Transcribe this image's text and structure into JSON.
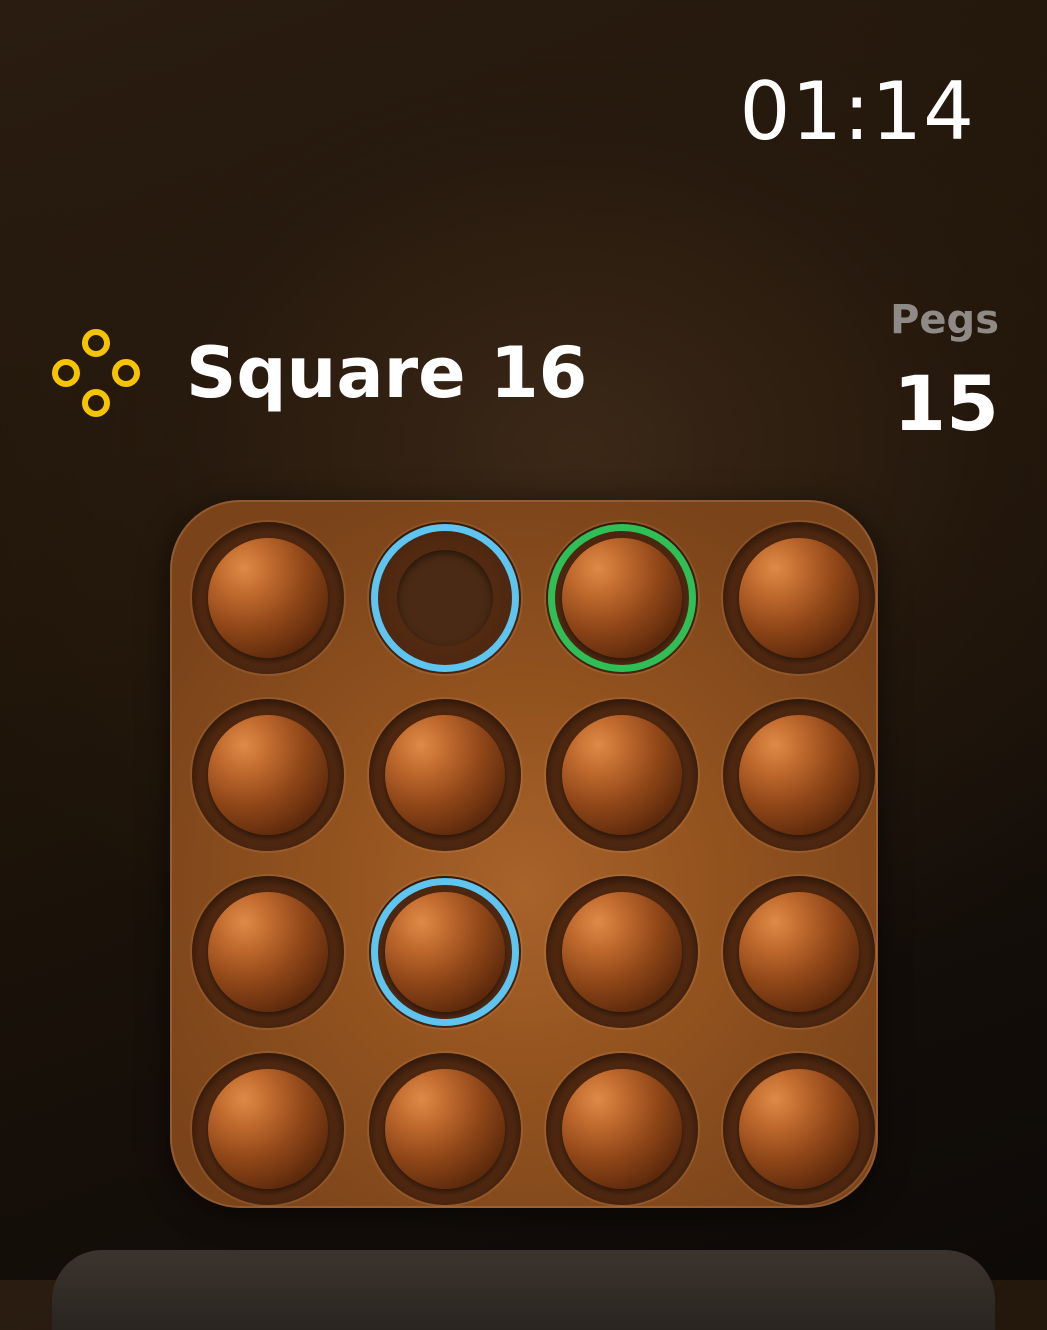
{
  "status": {
    "time": "01:14"
  },
  "header": {
    "title": "Square 16",
    "icon": "four-rings-icon",
    "icon_color": "#f5c400"
  },
  "pegs": {
    "label": "Pegs",
    "value": "15"
  },
  "colors": {
    "highlight_blue": "#5ec4f0",
    "highlight_green": "#2fbf56"
  },
  "board": {
    "rows": 4,
    "cols": 4,
    "cells": [
      {
        "peg": true,
        "ring": null
      },
      {
        "peg": false,
        "ring": "blue"
      },
      {
        "peg": true,
        "ring": "green"
      },
      {
        "peg": true,
        "ring": null
      },
      {
        "peg": true,
        "ring": null
      },
      {
        "peg": true,
        "ring": null
      },
      {
        "peg": true,
        "ring": null
      },
      {
        "peg": true,
        "ring": null
      },
      {
        "peg": true,
        "ring": null
      },
      {
        "peg": true,
        "ring": "blue"
      },
      {
        "peg": true,
        "ring": null
      },
      {
        "peg": true,
        "ring": null
      },
      {
        "peg": true,
        "ring": null
      },
      {
        "peg": true,
        "ring": null
      },
      {
        "peg": true,
        "ring": null
      },
      {
        "peg": true,
        "ring": null
      }
    ]
  }
}
